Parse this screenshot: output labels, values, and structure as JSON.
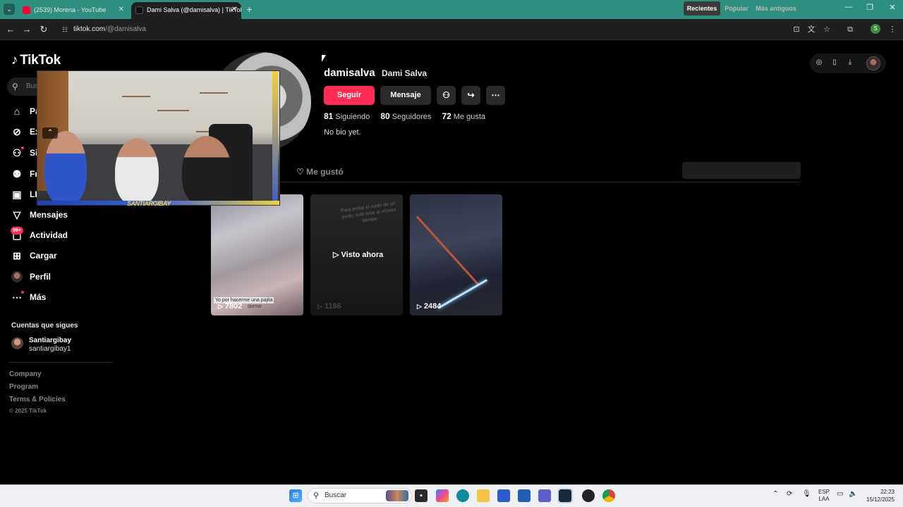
{
  "browser": {
    "tabs": [
      {
        "title": "(2539) Morena - YouTube",
        "favicon": "youtube-icon",
        "active": false
      },
      {
        "title": "Dami Salva (@damisalva) | TikTok",
        "favicon": "tiktok-icon",
        "active": true
      }
    ],
    "url_domain": "tiktok.com",
    "url_path": "/@damisalva",
    "profile_initial": "S"
  },
  "tiktok": {
    "logo_text": "TikTok",
    "search_placeholder": "Bus",
    "nav": [
      {
        "label": "Pa",
        "icon": "home-icon"
      },
      {
        "label": "Ex",
        "icon": "explore-icon"
      },
      {
        "label": "Si",
        "icon": "following-icon"
      },
      {
        "label": "Fr",
        "icon": "friends-icon"
      },
      {
        "label": "LI",
        "icon": "live-icon"
      },
      {
        "label": "Mensajes",
        "icon": "messages-icon"
      },
      {
        "label": "Actividad",
        "icon": "activity-icon",
        "badge": "99+"
      },
      {
        "label": "Cargar",
        "icon": "upload-icon"
      },
      {
        "label": "Perfil",
        "icon": "profile-icon"
      },
      {
        "label": "Más",
        "icon": "more-icon"
      }
    ],
    "following_section": {
      "title": "Cuentas que sigues",
      "accounts": [
        {
          "name": "Santiargibay",
          "username": "santiargibay1"
        }
      ]
    },
    "footer_links": [
      "Company",
      "Program",
      "Terms & Policies"
    ],
    "copyright": "© 2025 TikTok"
  },
  "profile": {
    "username": "damisalva",
    "nickname": "Dami Salva",
    "follow_label": "Seguir",
    "message_label": "Mensaje",
    "following_count": "81",
    "following_label": "Siguiendo",
    "followers_count": "80",
    "followers_label": "Seguidores",
    "likes_count": "72",
    "likes_label": "Me gusta",
    "bio": "No bio yet.",
    "liked_tab_label": "Me gustó",
    "sort_options": [
      "Recientes",
      "Popular",
      "Más antiguos"
    ],
    "sort_selected": "Recientes"
  },
  "videos": [
    {
      "views": "7802",
      "caption": "Yo por hacerme una pajita",
      "caption2": "dormir"
    },
    {
      "views": "1186",
      "overlay": "Visto ahora",
      "note": "Para evitar el ruido de un pedo, solo tose al mismo tiempo"
    },
    {
      "views": "2484"
    }
  ],
  "overlay": {
    "brand_text": "SANTIARGIBAY"
  },
  "taskbar": {
    "search_label": "Buscar",
    "lang_line1": "ESP",
    "lang_line2": "LAA",
    "time": "22:23",
    "date": "15/12/2025"
  },
  "colors": {
    "accent": "#fe2c55",
    "tab_bar": "#2e8f7e",
    "background": "#000000"
  }
}
